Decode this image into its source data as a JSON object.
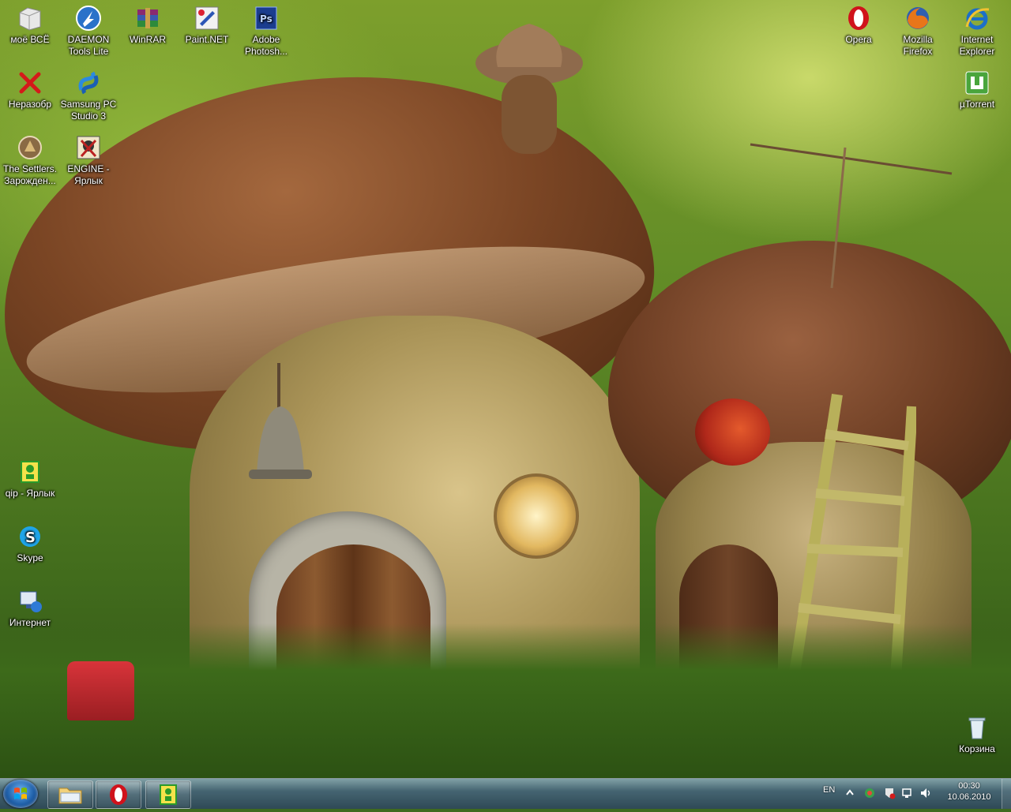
{
  "desktop": {
    "icons": [
      {
        "id": "moe-vse",
        "label": "моё ВСЁ",
        "icon": "folder-documents-icon"
      },
      {
        "id": "daemon",
        "label": "DAEMON\nTools Lite",
        "icon": "daemon-tools-icon"
      },
      {
        "id": "winrar",
        "label": "WinRAR",
        "icon": "winrar-icon"
      },
      {
        "id": "paintnet",
        "label": "Paint.NET",
        "icon": "paintnet-icon"
      },
      {
        "id": "photoshop",
        "label": "Adobe\nPhotosh...",
        "icon": "photoshop-icon"
      },
      {
        "id": "opera",
        "label": "Opera",
        "icon": "opera-icon"
      },
      {
        "id": "firefox",
        "label": "Mozilla\nFirefox",
        "icon": "firefox-icon"
      },
      {
        "id": "ie",
        "label": "Internet\nExplorer",
        "icon": "internet-explorer-icon"
      },
      {
        "id": "nerazobr",
        "label": "Неразобр",
        "icon": "red-cross-icon"
      },
      {
        "id": "samsung",
        "label": "Samsung PC\nStudio 3",
        "icon": "samsung-pc-studio-icon"
      },
      {
        "id": "utorrent",
        "label": "µTorrent",
        "icon": "utorrent-icon"
      },
      {
        "id": "settlers",
        "label": "The Settlers.\nЗарожден...",
        "icon": "settlers-game-icon"
      },
      {
        "id": "engine",
        "label": "ENGINE -\nЯрлык",
        "icon": "engine-shortcut-icon"
      },
      {
        "id": "qip",
        "label": "qip - Ярлык",
        "icon": "qip-icon"
      },
      {
        "id": "skype",
        "label": "Skype",
        "icon": "skype-icon"
      },
      {
        "id": "internet",
        "label": "Интернет",
        "icon": "network-internet-icon"
      },
      {
        "id": "recycle",
        "label": "Корзина",
        "icon": "recycle-bin-icon"
      }
    ]
  },
  "taskbar": {
    "start_icon": "windows-start-icon",
    "pinned": [
      {
        "id": "explorer",
        "icon": "folder-explorer-icon"
      },
      {
        "id": "opera",
        "icon": "opera-icon"
      },
      {
        "id": "qip",
        "icon": "qip-icon"
      }
    ],
    "tray": {
      "language": "EN",
      "time": "00:30",
      "date": "10.06.2010"
    }
  },
  "colors": {
    "taskbar_top": "#8caabe",
    "taskbar_bottom": "#2d465a",
    "opera_red": "#d0121b",
    "ie_blue": "#1c6fc8"
  }
}
